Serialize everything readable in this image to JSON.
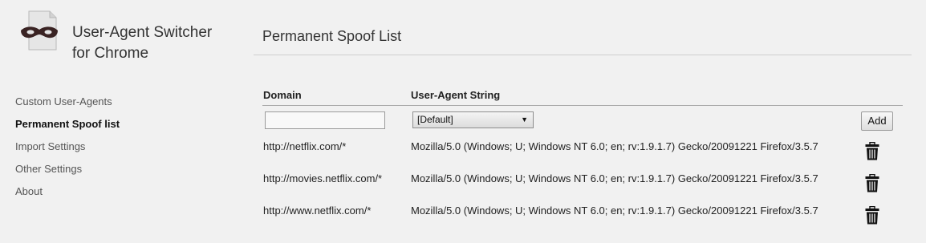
{
  "app": {
    "title_line1": "User-Agent Switcher",
    "title_line2": "for Chrome"
  },
  "sidebar": {
    "items": [
      {
        "label": "Custom User-Agents",
        "active": false
      },
      {
        "label": "Permanent Spoof list",
        "active": true
      },
      {
        "label": "Import Settings",
        "active": false
      },
      {
        "label": "Other Settings",
        "active": false
      },
      {
        "label": "About",
        "active": false
      }
    ]
  },
  "main": {
    "title": "Permanent Spoof List",
    "columns": {
      "domain": "Domain",
      "ua": "User-Agent String"
    },
    "new_entry": {
      "domain_value": "",
      "ua_selected": "[Default]",
      "add_label": "Add"
    },
    "rows": [
      {
        "domain": "http://netflix.com/*",
        "ua": "Mozilla/5.0 (Windows; U; Windows NT 6.0; en; rv:1.9.1.7) Gecko/20091221 Firefox/3.5.7"
      },
      {
        "domain": "http://movies.netflix.com/*",
        "ua": "Mozilla/5.0 (Windows; U; Windows NT 6.0; en; rv:1.9.1.7) Gecko/20091221 Firefox/3.5.7"
      },
      {
        "domain": "http://www.netflix.com/*",
        "ua": "Mozilla/5.0 (Windows; U; Windows NT 6.0; en; rv:1.9.1.7) Gecko/20091221 Firefox/3.5.7"
      }
    ]
  },
  "icons": {
    "logo": "mask-document-icon",
    "delete": "trash-icon",
    "select_arrow": "chevron-down-icon"
  }
}
